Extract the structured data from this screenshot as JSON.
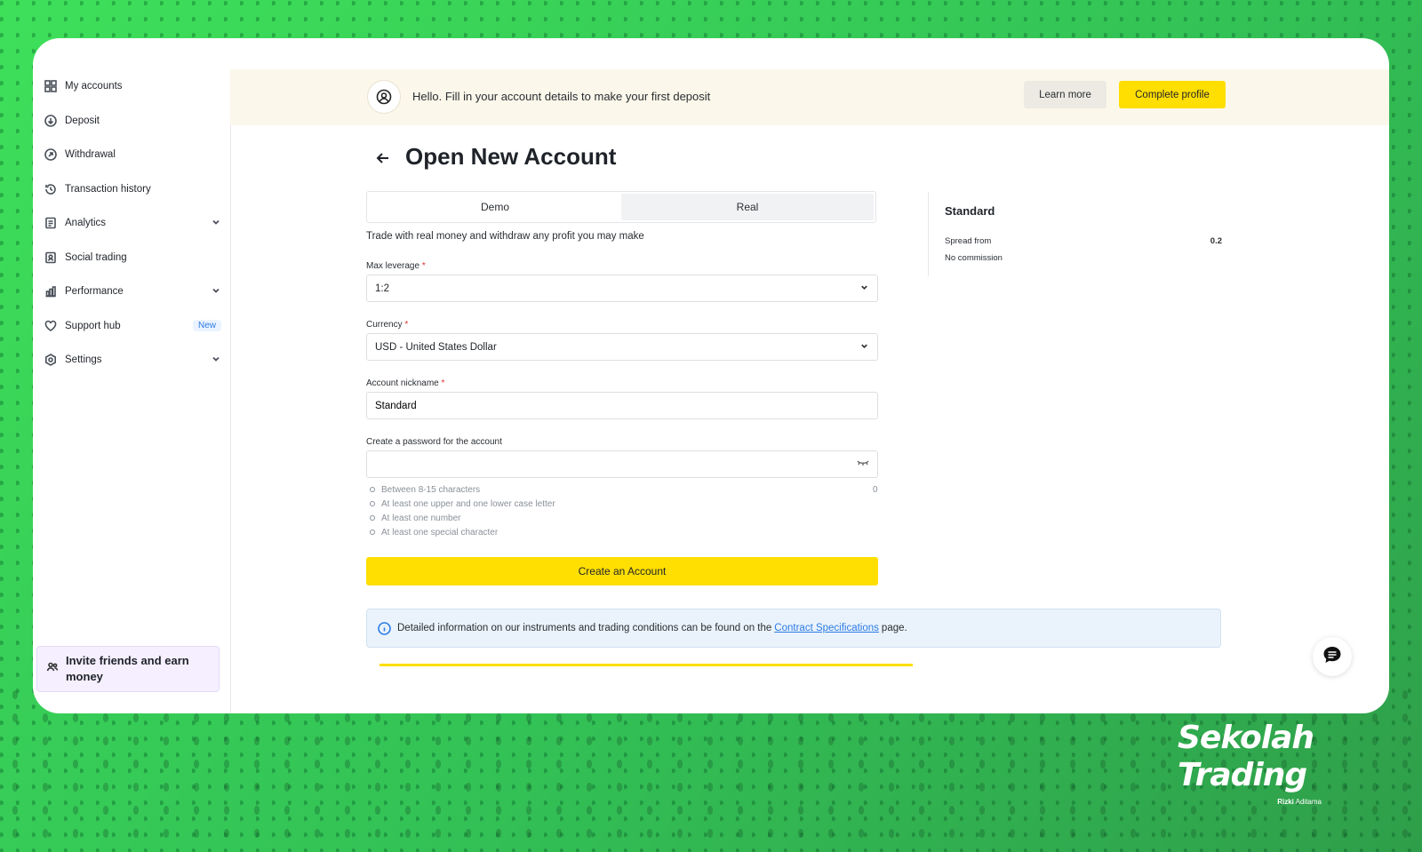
{
  "sidebar": {
    "items": [
      {
        "label": "My accounts",
        "icon": "grid-icon"
      },
      {
        "label": "Deposit",
        "icon": "deposit-icon"
      },
      {
        "label": "Withdrawal",
        "icon": "withdrawal-icon"
      },
      {
        "label": "Transaction history",
        "icon": "history-icon"
      },
      {
        "label": "Analytics",
        "icon": "analytics-icon"
      },
      {
        "label": "Social trading",
        "icon": "social-icon"
      },
      {
        "label": "Performance",
        "icon": "bar-chart-icon"
      },
      {
        "label": "Support hub",
        "icon": "heart-icon",
        "badge": "New"
      },
      {
        "label": "Settings",
        "icon": "gear-icon"
      }
    ],
    "invite_label": "Invite friends and earn money"
  },
  "banner": {
    "message": "Hello. Fill in your account details to make your first deposit",
    "learn_more": "Learn more",
    "complete_profile": "Complete profile"
  },
  "main": {
    "title": "Open New Account",
    "tabs": [
      {
        "label": "Demo"
      },
      {
        "label": "Real"
      }
    ],
    "active_tab": "Real",
    "description": "Trade with real money and withdraw any profit you may make",
    "leverage": {
      "label": "Max leverage",
      "required": "*",
      "value": "1:2"
    },
    "currency": {
      "label": "Currency",
      "required": "*",
      "value": "USD - United States Dollar"
    },
    "nickname": {
      "label": "Account nickname",
      "required": "*",
      "value": "Standard"
    },
    "password": {
      "label": "Create a password for the account",
      "value": "",
      "count": "0"
    },
    "password_rules": [
      "Between 8-15 characters",
      "At least one upper and one lower case letter",
      "At least one number",
      "At least one special character"
    ],
    "create_button": "Create an Account",
    "info": {
      "text_before": "Detailed information on our instruments and trading conditions can be found on the",
      "link": "Contract Specifications",
      "text_after": "page."
    }
  },
  "summary": {
    "title": "Standard",
    "spread_label": "Spread from",
    "spread_value": "0.2",
    "commission": "No commission"
  },
  "logo": {
    "line1": "Sekolah",
    "line2": "Trading",
    "first_name": "Rizki",
    "last_name": "Aditama"
  },
  "colors": {
    "accent": "#ffde02",
    "background": "#3fcf5a",
    "link": "#2c7be5"
  }
}
